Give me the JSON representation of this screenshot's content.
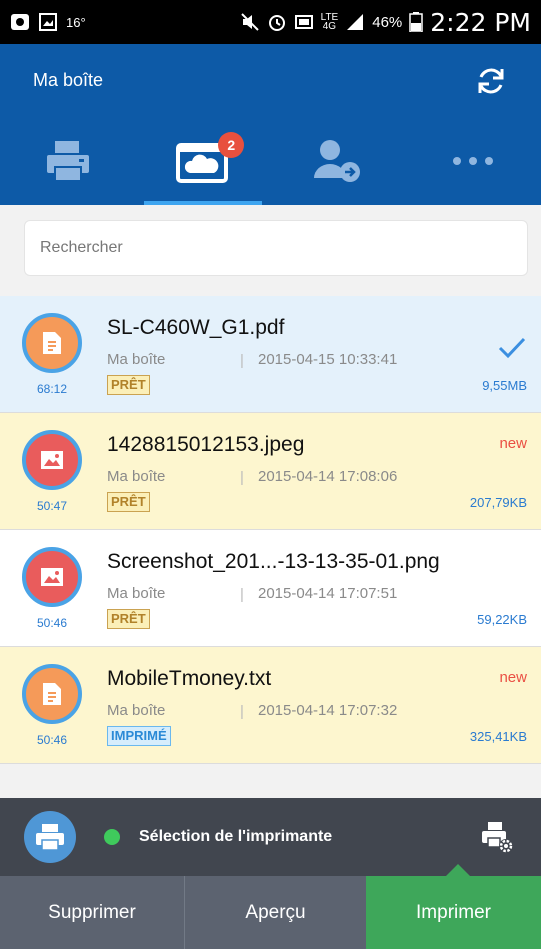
{
  "status_bar": {
    "temperature": "16°",
    "network": "LTE",
    "network_sub": "4G",
    "battery": "46%",
    "time": "2:22 PM"
  },
  "header": {
    "title": "Ma boîte"
  },
  "tabs": [
    {
      "icon": "printer-icon",
      "active": false
    },
    {
      "icon": "cloud-box-icon",
      "active": true,
      "badge": "2"
    },
    {
      "icon": "user-forward-icon",
      "active": false
    },
    {
      "icon": "more-icon",
      "active": false
    }
  ],
  "search": {
    "placeholder": "Rechercher",
    "value": ""
  },
  "files": [
    {
      "name": "SL-C460W_G1.pdf",
      "location": "Ma boîte",
      "date": "2015-04-15 10:33:41",
      "status": "PRÊT",
      "size": "9,55MB",
      "timer": "68:12",
      "type": "document",
      "selected": true,
      "new": ""
    },
    {
      "name": "1428815012153.jpeg",
      "location": "Ma boîte",
      "date": "2015-04-14 17:08:06",
      "status": "PRÊT",
      "size": "207,79KB",
      "timer": "50:47",
      "type": "image",
      "selected": false,
      "new": "new"
    },
    {
      "name": "Screenshot_201...-13-13-35-01.png",
      "location": "Ma boîte",
      "date": "2015-04-14 17:07:51",
      "status": "PRÊT",
      "size": "59,22KB",
      "timer": "50:46",
      "type": "image",
      "selected": false,
      "new": ""
    },
    {
      "name": "MobileTmoney.txt",
      "location": "Ma boîte",
      "date": "2015-04-14 17:07:32",
      "status": "IMPRIMÉ",
      "size": "325,41KB",
      "timer": "50:46",
      "type": "document",
      "selected": false,
      "new": "new"
    }
  ],
  "printer_bar": {
    "label": "Sélection de l'imprimante",
    "status_color": "#3fca5c"
  },
  "actions": {
    "delete": "Supprimer",
    "preview": "Aperçu",
    "print": "Imprimer"
  },
  "colors": {
    "header_blue": "#0d5aa7",
    "selected_row": "#e4f1fb",
    "new_row": "#fdf6cf",
    "print_green": "#3ea75a",
    "toolbar_gray": "#5c6370"
  }
}
